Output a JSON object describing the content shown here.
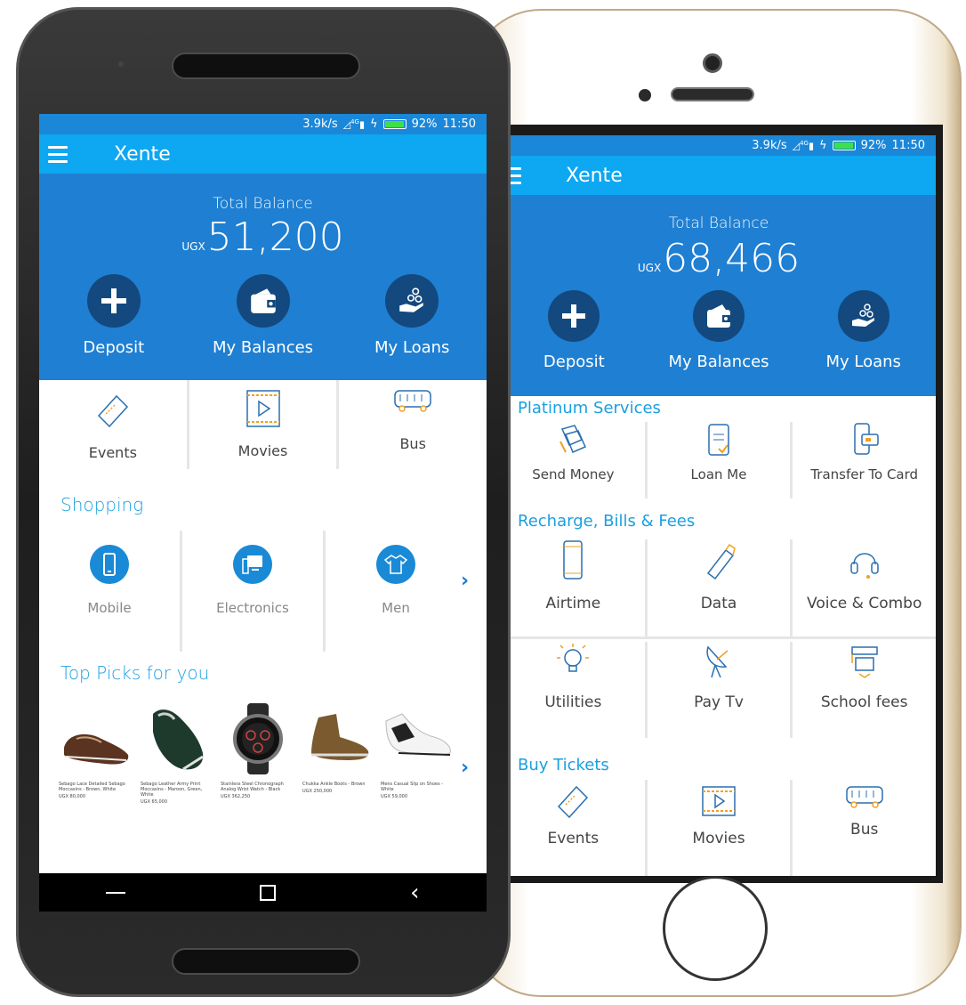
{
  "statusbar": {
    "speed": "3.9k/s",
    "network": "4G",
    "battery": "92%",
    "time": "11:50"
  },
  "app": {
    "title": "Xente",
    "balance_label": "Total Balance",
    "currency": "UGX"
  },
  "android": {
    "balance": "51,200",
    "actions": [
      "Deposit",
      "My Balances",
      "My Loans"
    ],
    "tickets": [
      "Events",
      "Movies",
      "Bus"
    ],
    "shopping_title": "Shopping",
    "shopping": [
      "Mobile",
      "Electronics",
      "Men"
    ],
    "top_picks_title": "Top Picks for you",
    "products": [
      {
        "name": "Sebago Lace Detailed Sebago Moccasins - Brown, White",
        "price": "UGX 80,000"
      },
      {
        "name": "Sebago Leather Army Print Moccasins - Maroon, Green, White",
        "price": "UGX 65,000"
      },
      {
        "name": "Stainless Steel Chronograph Analog Wrist Watch - Black",
        "price": "UGX 362,250"
      },
      {
        "name": "Chukka Ankle Boots - Brown",
        "price": "UGX 250,000"
      },
      {
        "name": "Mens Casual Slip on Shoes - White",
        "price": "UGX 59,000"
      }
    ]
  },
  "iphone": {
    "balance": "68,466",
    "actions": [
      "Deposit",
      "My Balances",
      "My Loans"
    ],
    "platinum_title": "Platinum Services",
    "platinum": [
      "Send Money",
      "Loan Me",
      "Transfer To Card"
    ],
    "recharge_title": "Recharge, Bills & Fees",
    "recharge_row1": [
      "Airtime",
      "Data",
      "Voice & Combo"
    ],
    "recharge_row2": [
      "Utilities",
      "Pay Tv",
      "School fees"
    ],
    "tickets_title": "Buy Tickets",
    "tickets": [
      "Events",
      "Movies",
      "Bus"
    ]
  },
  "colors": {
    "primary": "#1f7fd2",
    "appbar": "#0ea7f1",
    "action_circle": "#13497e",
    "accent": "#1a9fe0",
    "icon_orange": "#f0a020"
  }
}
